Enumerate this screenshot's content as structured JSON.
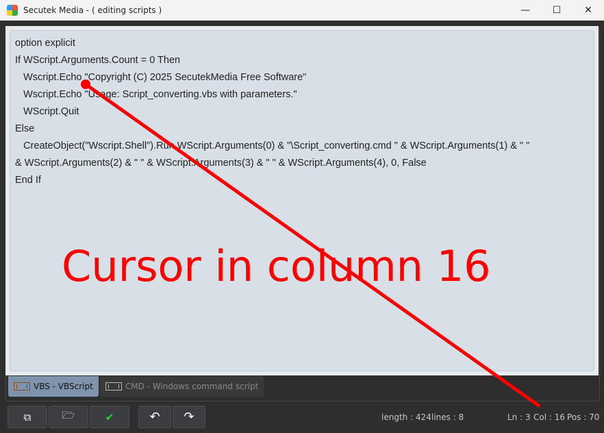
{
  "window": {
    "title": "Secutek Media - ( editing scripts )",
    "minimize": "—",
    "maximize": "☐",
    "close": "✕"
  },
  "editor": {
    "lines": [
      "option explicit",
      "If WScript.Arguments.Count = 0 Then",
      "   Wscript.Echo \"Copyright (C) 2025 SecutekMedia Free Software\"",
      "   Wscript.Echo \"Usage: Script_converting.vbs with parameters.\"",
      "   WScript.Quit",
      "Else",
      "   CreateObject(\"Wscript.Shell\").Run WScript.Arguments(0) & \"\\Script_converting.cmd \" & WScript.Arguments(1) & \" \"",
      "& WScript.Arguments(2) & \" \" & WScript.Arguments(3) & \" \" & WScript.Arguments(4), 0, False",
      "End If"
    ]
  },
  "tabs": [
    {
      "label": "VBS - VBScript",
      "active": true
    },
    {
      "label": "CMD - Windows command script",
      "active": false
    }
  ],
  "toolbar": {
    "copy": "⧉",
    "open": "🗁",
    "apply": "✔",
    "undo": "↶",
    "redo": "↷"
  },
  "status": {
    "length": "length : 424",
    "lines": "lines : 8",
    "ln": "Ln : 3",
    "col": "Col : 16",
    "pos": "Pos : 70"
  },
  "annotation": {
    "text": "Cursor in column 16",
    "color": "#ff0000"
  }
}
